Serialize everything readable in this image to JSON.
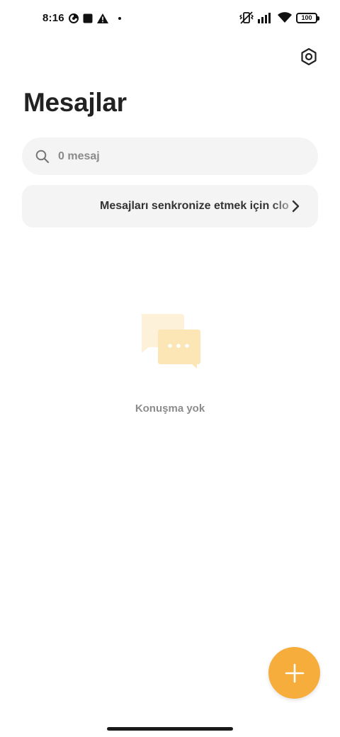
{
  "status_bar": {
    "time": "8:16",
    "battery": "100",
    "icons": [
      "data-saver-icon",
      "stop-square-icon",
      "warning-icon",
      "dot-icon",
      "vibrate-off-icon",
      "signal-icon",
      "wifi-icon",
      "battery-icon"
    ]
  },
  "header": {
    "title": "Mesajlar",
    "settings_icon": "settings-hex-icon"
  },
  "search": {
    "placeholder": "0 mesaj",
    "icon": "search-icon"
  },
  "sync_banner": {
    "text": "Mesajları senkronize etmek için clo",
    "icon": "chevron-right-icon"
  },
  "empty_state": {
    "illustration": "chat-bubbles-icon",
    "text": "Konuşma yok"
  },
  "fab": {
    "icon": "plus-icon"
  },
  "colors": {
    "accent": "#f6ad3b",
    "surface": "#f4f4f4",
    "text_primary": "#222222",
    "text_muted": "#8c8c8c",
    "illustration_light": "#fdf1d9",
    "illustration_dark": "#fde6b6"
  }
}
